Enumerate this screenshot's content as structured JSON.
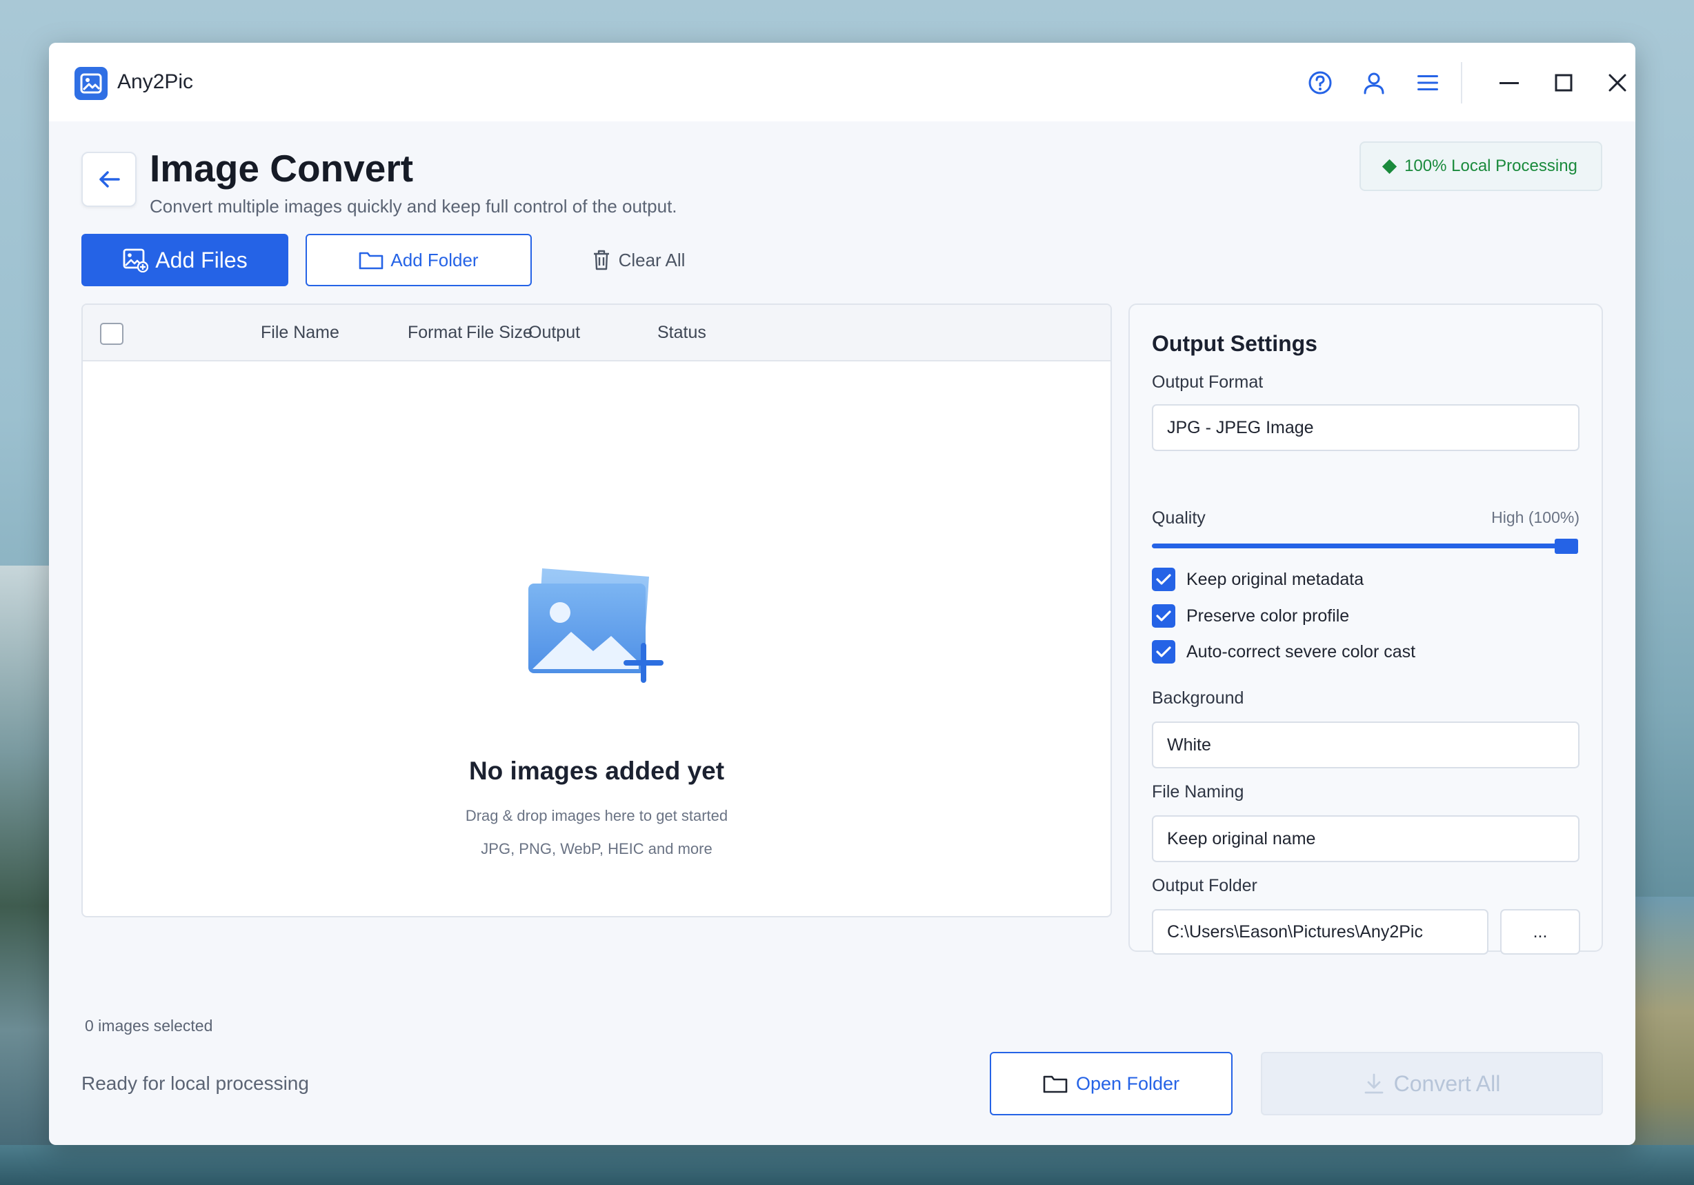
{
  "app": {
    "name": "Any2Pic"
  },
  "titlebar": {
    "icons": [
      "help-icon",
      "user-icon",
      "menu-icon",
      "minimize-icon",
      "maximize-icon",
      "close-icon"
    ]
  },
  "header": {
    "title": "Image Convert",
    "subtitle": "Convert multiple images quickly and keep full control of the output.",
    "badge": "100% Local Processing"
  },
  "toolbar": {
    "add_files": "Add Files",
    "add_folder": "Add Folder",
    "clear_all": "Clear All"
  },
  "table": {
    "columns": [
      "File Name",
      "Format",
      "File Size",
      "Output",
      "Status"
    ]
  },
  "empty": {
    "title": "No images added yet",
    "subtitle": "Drag & drop images here to get started",
    "formats": "JPG, PNG, WebP, HEIC and more"
  },
  "footer": {
    "selected": "0 images selected",
    "status": "Ready for local processing",
    "open_folder": "Open Folder",
    "convert_all": "Convert All"
  },
  "settings": {
    "title": "Output Settings",
    "output_format_label": "Output Format",
    "output_format_value": "JPG - JPEG Image",
    "quality_label": "Quality",
    "quality_value": "High (100%)",
    "quality_level": 1.0,
    "checkboxes": [
      {
        "label": "Keep original metadata",
        "checked": true
      },
      {
        "label": "Preserve color profile",
        "checked": true
      },
      {
        "label": "Auto-correct severe color cast",
        "checked": true
      }
    ],
    "background_label": "Background",
    "background_value": "White",
    "file_naming_label": "File Naming",
    "file_naming_value": "Keep original name",
    "output_folder_label": "Output Folder",
    "output_folder_value": "C:\\Users\\Eason\\Pictures\\Any2Pic",
    "browse_label": "..."
  },
  "colors": {
    "accent": "#2563e6",
    "badge_green": "#1a8a3c",
    "disabled": "#b7c5d9"
  }
}
